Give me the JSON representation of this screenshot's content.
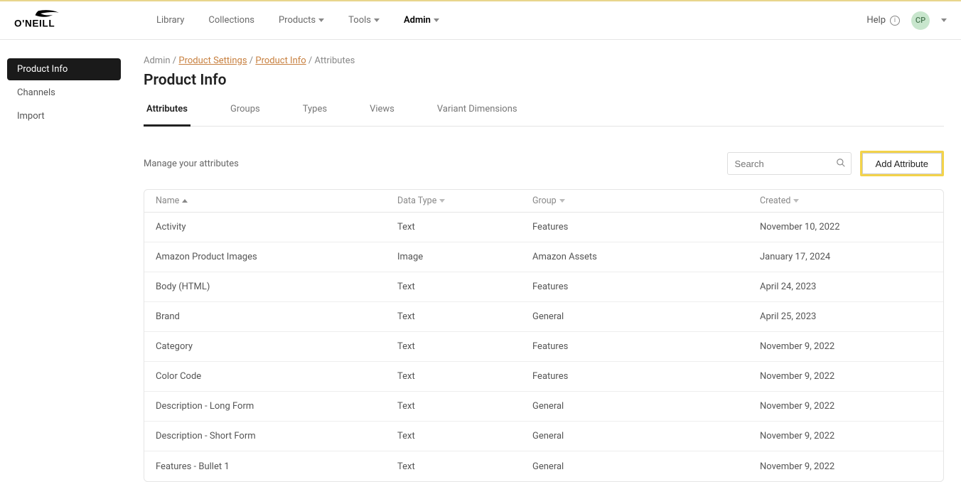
{
  "header": {
    "nav": [
      "Library",
      "Collections",
      "Products",
      "Tools",
      "Admin"
    ],
    "active_nav": "Admin",
    "help": "Help",
    "avatar_initials": "CP"
  },
  "sidebar": {
    "items": [
      "Product Info",
      "Channels",
      "Import"
    ],
    "active": "Product Info"
  },
  "breadcrumb": {
    "root": "Admin",
    "product_settings": "Product Settings",
    "product_info": "Product Info",
    "current": "Attributes"
  },
  "page_title": "Product Info",
  "tabs": [
    "Attributes",
    "Groups",
    "Types",
    "Views",
    "Variant Dimensions"
  ],
  "active_tab": "Attributes",
  "toolbar": {
    "desc": "Manage your attributes",
    "search_placeholder": "Search",
    "add_label": "Add Attribute"
  },
  "columns": {
    "name": "Name",
    "data_type": "Data Type",
    "group": "Group",
    "created": "Created"
  },
  "rows": [
    {
      "name": "Activity",
      "type": "Text",
      "group": "Features",
      "created": "November 10, 2022"
    },
    {
      "name": "Amazon Product Images",
      "type": "Image",
      "group": "Amazon Assets",
      "created": "January 17, 2024"
    },
    {
      "name": "Body (HTML)",
      "type": "Text",
      "group": "Features",
      "created": "April 24, 2023"
    },
    {
      "name": "Brand",
      "type": "Text",
      "group": "General",
      "created": "April 25, 2023"
    },
    {
      "name": "Category",
      "type": "Text",
      "group": "Features",
      "created": "November 9, 2022"
    },
    {
      "name": "Color Code",
      "type": "Text",
      "group": "Features",
      "created": "November 9, 2022"
    },
    {
      "name": "Description - Long Form",
      "type": "Text",
      "group": "General",
      "created": "November 9, 2022"
    },
    {
      "name": "Description - Short Form",
      "type": "Text",
      "group": "General",
      "created": "November 9, 2022"
    },
    {
      "name": "Features - Bullet 1",
      "type": "Text",
      "group": "General",
      "created": "November 9, 2022"
    }
  ]
}
